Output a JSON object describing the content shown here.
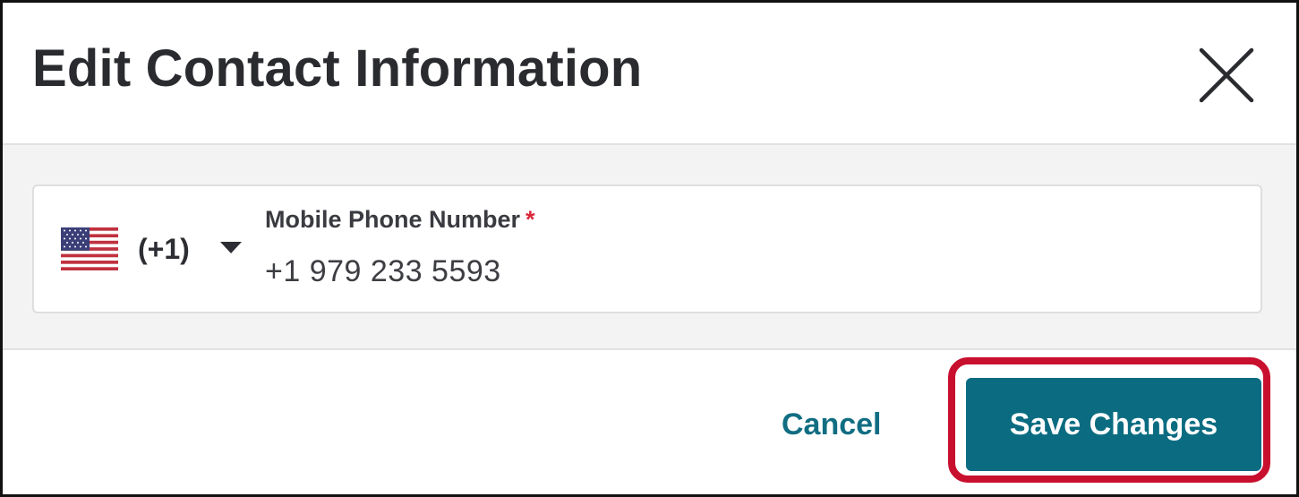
{
  "dialog": {
    "title": "Edit Contact Information",
    "close_icon": "close-icon"
  },
  "phone": {
    "flag_icon": "us-flag-icon",
    "country_code": "(+1)",
    "dropdown_icon": "caret-down-icon",
    "label": "Mobile Phone Number",
    "required_marker": "*",
    "value": "+1 979 233 5593"
  },
  "footer": {
    "cancel_label": "Cancel",
    "save_label": "Save Changes"
  },
  "colors": {
    "accent": "#0b6c81",
    "link": "#116d82",
    "required": "#d9283a",
    "highlight": "#c8102e"
  }
}
